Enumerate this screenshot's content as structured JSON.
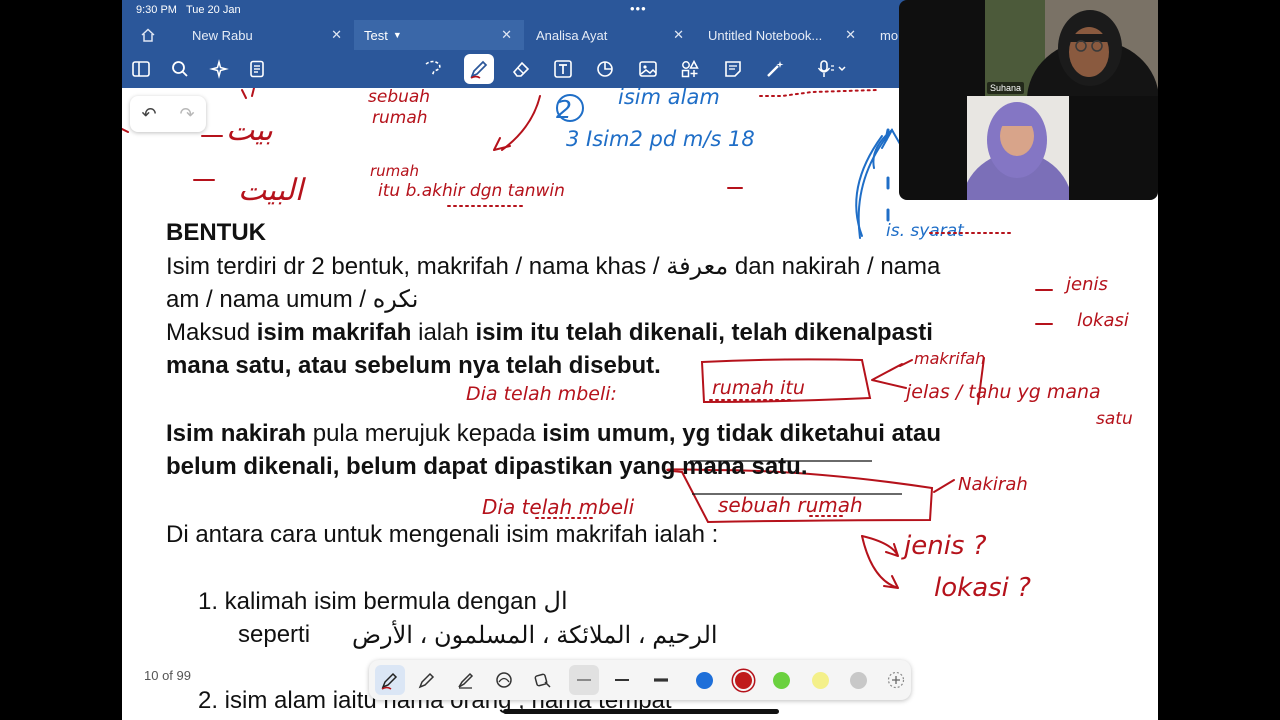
{
  "status_bar": {
    "time": "9:30 PM",
    "date": "Tue 20 Jan"
  },
  "tabs": [
    {
      "label": "New Rabu"
    },
    {
      "label": "Test"
    },
    {
      "label": "Analisa Ayat"
    },
    {
      "label": "Untitled Notebook..."
    },
    {
      "label": "mo"
    }
  ],
  "toolbar_icons": [
    "sidebar-icon",
    "search-icon",
    "magic-icon",
    "notes-icon",
    "lasso-icon",
    "pen-icon",
    "eraser-icon",
    "text-icon",
    "shapes-icon",
    "image-icon",
    "stickers-icon",
    "sticky-note-icon",
    "laser-icon",
    "microphone-icon"
  ],
  "document": {
    "heading": "BENTUK",
    "p1_line1": "Isim terdiri dr 2 bentuk, makrifah / nama khas / معرفة dan nakirah  / nama",
    "p1_line2": "am  / nama umum / نكره",
    "p2_a": "Maksud ",
    "p2_b": "isim makrifah",
    "p2_c": " ialah ",
    "p2_d": "isim itu telah dikenali, telah dikenalpasti",
    "p2_line2": "mana satu, atau sebelum nya telah disebut.",
    "p3_a": "Isim nakirah",
    "p3_b": " pula merujuk kepada ",
    "p3_c": "isim umum, yg tidak diketahui atau",
    "p3_line2": "belum dikenali, belum dapat dipastikan yang mana satu.",
    "p4": "Di antara cara untuk mengenali isim makrifah ialah :",
    "item1": "1. kalimah isim bermula dengan ال",
    "item1_ex_label": "seperti",
    "item1_ex_arabic": "الرحيم ، الملائكة ، المسلمون ، الأرض",
    "item2": "2. isim alam iaitu nama orang , nama tempat"
  },
  "handwriting": {
    "top_left_1": "sebuah",
    "top_left_2": "rumah",
    "top_left_arabic_1": "بيت",
    "top_left_arabic_2": "البيت",
    "top_left_3": "rumah",
    "top_left_4": "itu  b.akhir  dgn  tanwin",
    "top_right_1": "isim alam",
    "top_right_2": "3  Isim2  pd  m/s  18",
    "top_right_2_num": "2",
    "side_1": "is. syarat",
    "right_jenis": "jenis",
    "right_lokasi": "lokasi",
    "makrifah_note": "makrifah",
    "example_1_prefix": "Dia telah mbeli:",
    "example_1_box": "rumah itu",
    "example_1_note": "jelas / tahu yg mana",
    "example_1_note2": "satu",
    "nakirah_note": "Nakirah",
    "example_2_prefix": "Dia telah mbeli",
    "example_2_box": "sebuah rumah",
    "q1": "jenis ?",
    "q2": "lokasi ?"
  },
  "page_counter": "10 of 99",
  "pen_colors": [
    "#1e6fd9",
    "#c01a1a",
    "#6bd13f",
    "#f4f08a",
    "#c8c8c8"
  ],
  "ink_colors": {
    "red": "#b5121b",
    "blue": "#1f6ec7"
  },
  "video": {
    "participant_label": "Suhana"
  }
}
